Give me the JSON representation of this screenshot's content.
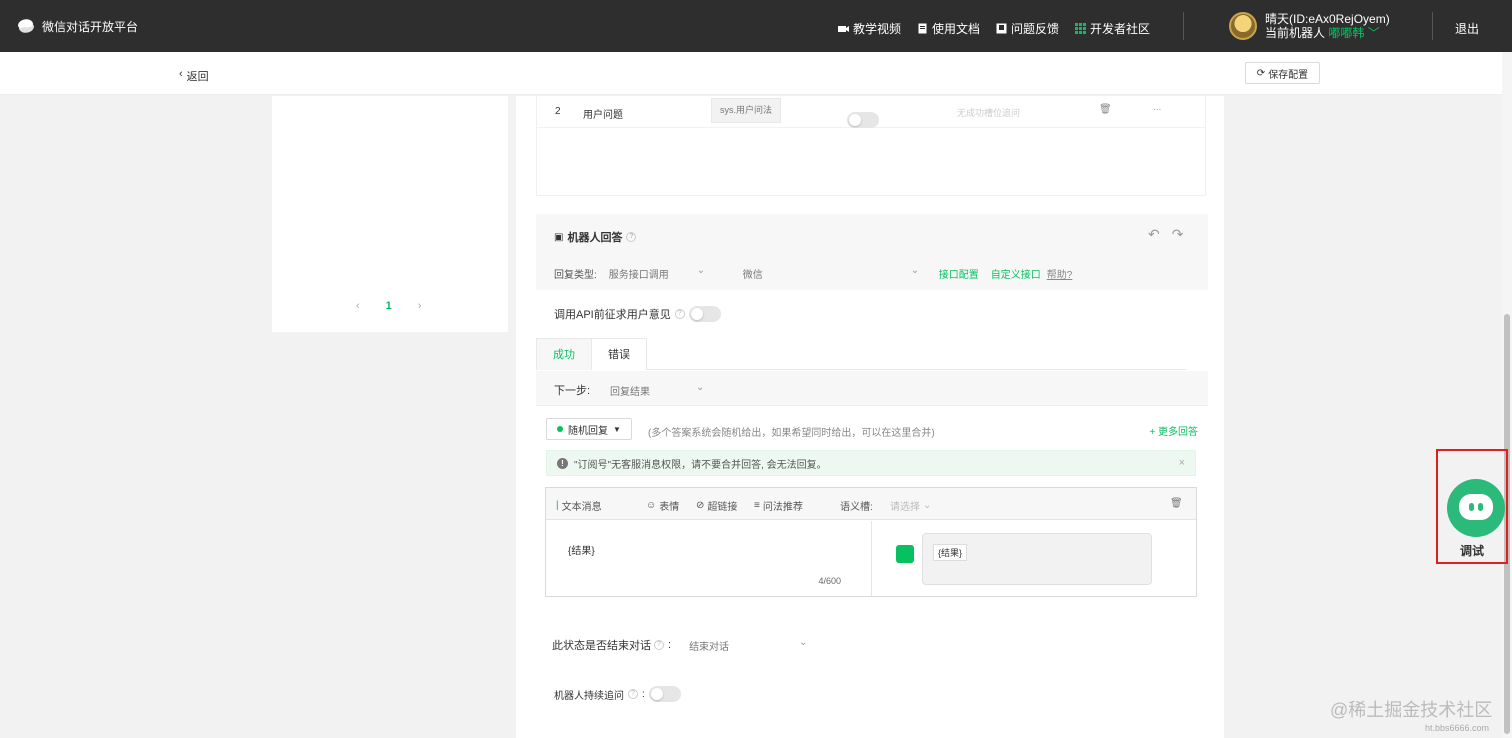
{
  "header": {
    "brand": "微信对话开放平台",
    "nav": [
      {
        "label": "教学视频",
        "icon": "video-icon"
      },
      {
        "label": "使用文档",
        "icon": "document-icon"
      },
      {
        "label": "问题反馈",
        "icon": "feedback-icon"
      },
      {
        "label": "开发者社区",
        "icon": "community-grid-icon"
      }
    ],
    "user_name": "晴天(ID:eAx0RejOyem)",
    "robot_prefix": "当前机器人",
    "robot_name": "嘟嘟韩",
    "logout": "退出"
  },
  "subbar": {
    "back": "返回",
    "save": "保存配置"
  },
  "pager": {
    "prev": "‹",
    "current": "1",
    "next": "›"
  },
  "table_row": {
    "index": "2",
    "name": "用户问题",
    "tag": "sys.用户问法",
    "placeholder": "无成功槽位追问",
    "more": "..."
  },
  "reply": {
    "title": "机器人回答",
    "type_label": "回复类型:",
    "type_value": "服务接口调用",
    "channel_value": "微信",
    "api_config": "接口配置",
    "custom_api": "自定义接口",
    "help": "帮助?",
    "api_consent": "调用API前征求用户意见",
    "tabs": [
      "成功",
      "错误"
    ],
    "next_label": "下一步:",
    "next_value": "回复结果",
    "random_btn": "随机回复",
    "random_hint": "(多个答案系统会随机给出，如果希望同时给出，可以在这里合并)",
    "more_reply": "+ 更多回答",
    "alert": "\"订阅号\"无客服消息权限，请不要合并回答, 会无法回复。",
    "msg_type": "文本消息",
    "tool_emoji": "表情",
    "tool_link": "超链接",
    "tool_recommend": "问法推荐",
    "slot_label": "语义槽:",
    "slot_placeholder": "请选择",
    "content": "{结果}",
    "count": "4/600",
    "preview_chip": "{结果}",
    "end_label": "此状态是否结束对话",
    "end_value": "结束对话",
    "follow_label": "机器人持续追问"
  },
  "debug": {
    "label": "调试"
  },
  "watermark": {
    "main": "@稀土掘金技术社区",
    "small": "ht.bbs6666.com"
  },
  "colors": {
    "accent": "#07c160",
    "header_bg": "#2e2e2e",
    "debug_border": "#e02020"
  }
}
